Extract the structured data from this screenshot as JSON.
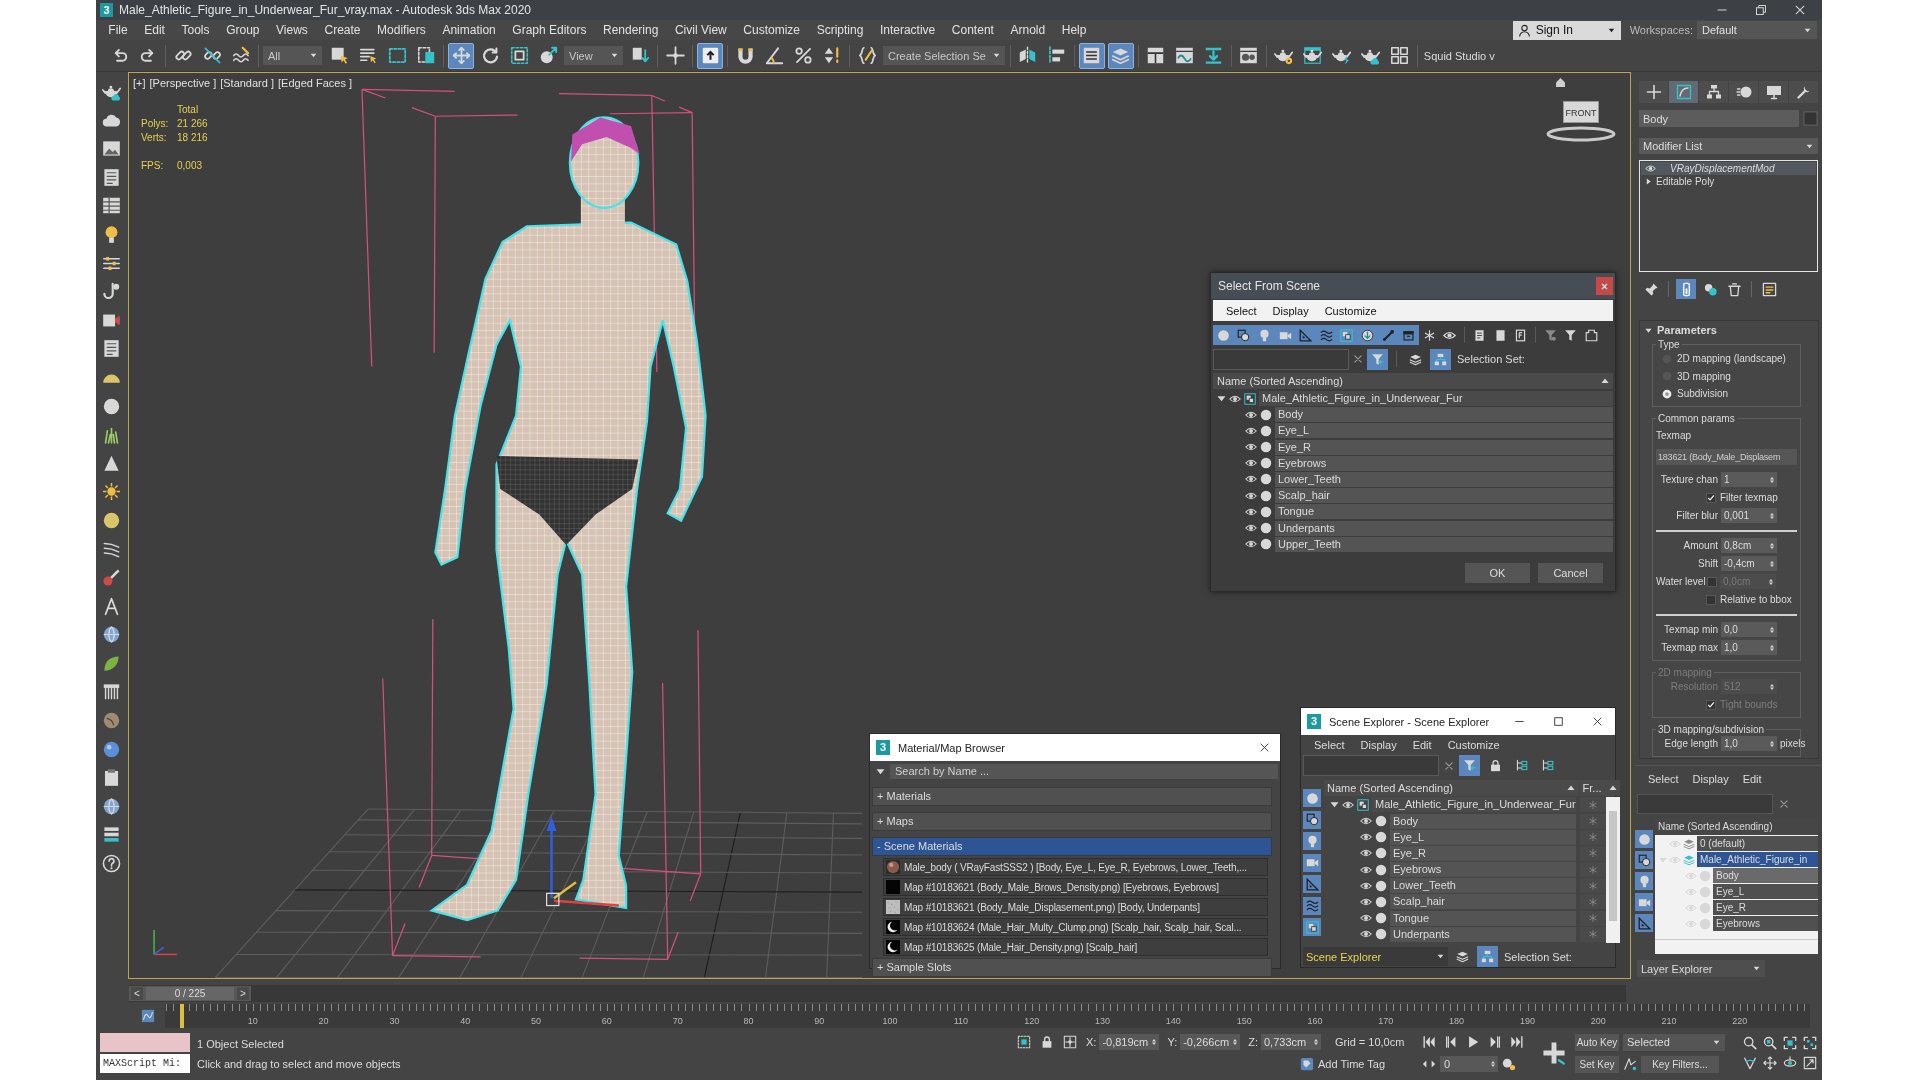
{
  "window": {
    "app_icon": "3",
    "title": "Male_Athletic_Figure_in_Underwear_Fur_vray.max - Autodesk 3ds Max 2020"
  },
  "menu_bar": {
    "items": [
      "File",
      "Edit",
      "Tools",
      "Group",
      "Views",
      "Create",
      "Modifiers",
      "Animation",
      "Graph Editors",
      "Rendering",
      "Civil View",
      "Customize",
      "Scripting",
      "Interactive",
      "Content",
      "Arnold",
      "Help"
    ],
    "sign_in": "Sign In",
    "workspaces_label": "Workspaces:",
    "workspace": "Default"
  },
  "main_toolbar": {
    "items": [
      {
        "kind": "tool",
        "selected": false
      },
      {
        "kind": "tool",
        "selected": false
      },
      {
        "kind": "separator"
      },
      {
        "kind": "tool",
        "selected": false
      },
      {
        "kind": "tool",
        "selected": false
      },
      {
        "kind": "tool",
        "selected": false
      },
      {
        "kind": "separator"
      },
      {
        "kind": "dropdown",
        "value": "All"
      },
      {
        "kind": "tool",
        "selected": false
      },
      {
        "kind": "tool",
        "selected": false
      },
      {
        "kind": "tool",
        "selected": false
      },
      {
        "kind": "tool",
        "selected": false
      },
      {
        "kind": "separator"
      },
      {
        "kind": "tool",
        "selected": true
      },
      {
        "kind": "tool",
        "selected": false
      },
      {
        "kind": "tool",
        "selected": false
      },
      {
        "kind": "tool",
        "selected": false
      },
      {
        "kind": "dropdown",
        "value": "View"
      },
      {
        "kind": "tool",
        "selected": false
      },
      {
        "kind": "separator"
      },
      {
        "kind": "tool",
        "selected": false
      },
      {
        "kind": "separator"
      },
      {
        "kind": "tool",
        "selected": true
      },
      {
        "kind": "separator"
      },
      {
        "kind": "tool",
        "selected": false
      },
      {
        "kind": "tool",
        "selected": false
      },
      {
        "kind": "tool",
        "selected": false
      },
      {
        "kind": "tool",
        "selected": false
      },
      {
        "kind": "separator"
      },
      {
        "kind": "tool",
        "selected": false
      },
      {
        "kind": "dropdown",
        "value": "Create Selection Se"
      },
      {
        "kind": "separator"
      },
      {
        "kind": "tool",
        "selected": false
      },
      {
        "kind": "tool",
        "selected": false
      },
      {
        "kind": "separator"
      },
      {
        "kind": "tool",
        "selected": true
      },
      {
        "kind": "tool",
        "selected": true
      },
      {
        "kind": "separator"
      },
      {
        "kind": "tool",
        "selected": false
      },
      {
        "kind": "tool",
        "selected": false
      },
      {
        "kind": "tool",
        "selected": false
      },
      {
        "kind": "separator"
      },
      {
        "kind": "tool",
        "selected": false
      },
      {
        "kind": "separator"
      },
      {
        "kind": "tool",
        "selected": false
      },
      {
        "kind": "tool",
        "selected": false
      },
      {
        "kind": "tool",
        "selected": false
      },
      {
        "kind": "tool",
        "selected": false
      },
      {
        "kind": "tool",
        "selected": false
      },
      {
        "kind": "separator"
      },
      {
        "kind": "label",
        "value": "Squid Studio v"
      }
    ]
  },
  "viewport": {
    "labels": [
      "[+]",
      "[Perspective ]",
      "[Standard ]",
      "[Edged Faces ]"
    ],
    "stats": {
      "heading": "Total",
      "rows": [
        {
          "label": "Polys:",
          "value": "21 266"
        },
        {
          "label": "Verts:",
          "value": "18 216"
        }
      ],
      "fps_label": "FPS:",
      "fps": "0,003"
    },
    "viewcube": "FRONT"
  },
  "select_from_scene": {
    "title": "Select From Scene",
    "menu": [
      "Select",
      "Display",
      "Customize"
    ],
    "filters": [
      {
        "selected": true
      },
      {
        "selected": true
      },
      {
        "selected": true
      },
      {
        "selected": true
      },
      {
        "selected": true
      },
      {
        "selected": true
      },
      {
        "selected": true
      },
      {
        "selected": true
      },
      {
        "selected": true
      },
      {
        "selected": true
      },
      {
        "selected": false
      },
      {
        "selected": false
      },
      {
        "selected": false
      },
      {
        "selected": false
      },
      {
        "selected": false
      },
      {
        "selected": false
      },
      {
        "selected": false
      },
      {
        "selected": false
      }
    ],
    "search_tools": [
      {
        "selected": true
      },
      {
        "selected": false
      },
      {
        "selected": true
      }
    ],
    "selection_set_label": "Selection Set:",
    "header": "Name (Sorted Ascending)",
    "tree": {
      "name": "Male_Athletic_Figure_in_Underwear_Fur",
      "selected": false,
      "expanded": true,
      "children": [
        {
          "name": "Body",
          "selected": false
        },
        {
          "name": "Eye_L",
          "selected": false
        },
        {
          "name": "Eye_R",
          "selected": false
        },
        {
          "name": "Eyebrows",
          "selected": false
        },
        {
          "name": "Lower_Teeth",
          "selected": false
        },
        {
          "name": "Scalp_hair",
          "selected": false
        },
        {
          "name": "Tongue",
          "selected": false
        },
        {
          "name": "Underpants",
          "selected": false
        },
        {
          "name": "Upper_Teeth",
          "selected": false
        }
      ]
    },
    "buttons": [
      "OK",
      "Cancel"
    ]
  },
  "material_browser": {
    "app_icon": "3",
    "title": "Material/Map Browser",
    "search_placeholder": "Search by Name ...",
    "groups": [
      {
        "label": "+ Materials",
        "selected": false
      },
      {
        "label": "+ Maps",
        "selected": false
      },
      {
        "label": "- Scene Materials",
        "selected": true,
        "items": [
          {
            "kind": "sphere",
            "text": "Male_body ( VRayFastSSS2 ) [Body, Eye_L, Eye_R, Eyebrows, Lower_Teeth,..."
          },
          {
            "kind": "solid",
            "text": "Map #10183621 (Body_Male_Brows_Density.png) [Eyebrows, Eyebrows]"
          },
          {
            "kind": "noise",
            "text": "Map #10183621 (Body_Male_Displasement.png) [Body, Underpants]"
          },
          {
            "kind": "crescent",
            "text": "Map #10183624 (Male_Hair_Multy_Clump.png) [Scalp_hair, Scalp_hair, Scal..."
          },
          {
            "kind": "crescent",
            "text": "Map #10183625 (Male_Hair_Density.png) [Scalp_hair]"
          }
        ]
      },
      {
        "label": "+ Sample Slots",
        "selected": false
      }
    ]
  },
  "scene_explorer": {
    "app_icon": "3",
    "title": "Scene Explorer - Scene Explorer",
    "menu": [
      "Select",
      "Display",
      "Edit",
      "Customize"
    ],
    "search_tools": [
      {
        "selected": true
      },
      {
        "selected": false
      },
      {
        "selected": false
      },
      {
        "selected": false
      }
    ],
    "side_filters": [
      {
        "selected": true
      },
      {
        "selected": true
      },
      {
        "selected": true
      },
      {
        "selected": true
      },
      {
        "selected": true
      },
      {
        "selected": true
      },
      {
        "selected": true
      }
    ],
    "header": "Name (Sorted Ascending)",
    "column_2": "Fr...",
    "tree": {
      "name": "Male_Athletic_Figure_in_Underwear_Fur",
      "selected": false,
      "expanded": true,
      "children": [
        {
          "name": "Body",
          "selected": false,
          "frozen": false
        },
        {
          "name": "Eye_L",
          "selected": false,
          "frozen": false
        },
        {
          "name": "Eye_R",
          "selected": false,
          "frozen": false
        },
        {
          "name": "Eyebrows",
          "selected": false,
          "frozen": false
        },
        {
          "name": "Lower_Teeth",
          "selected": false,
          "frozen": false
        },
        {
          "name": "Scalp_hair",
          "selected": false,
          "frozen": false
        },
        {
          "name": "Tongue",
          "selected": false,
          "frozen": false
        },
        {
          "name": "Underpants",
          "selected": false,
          "frozen": false
        }
      ]
    },
    "explorer_name": "Scene Explorer",
    "footer_tools": [
      {
        "selected": false
      },
      {
        "selected": true
      }
    ],
    "selection_set_label": "Selection Set:"
  },
  "command_panel": {
    "tabs": [
      {
        "selected": false
      },
      {
        "selected": true
      },
      {
        "selected": false
      },
      {
        "selected": false
      },
      {
        "selected": false
      },
      {
        "selected": false
      }
    ],
    "object_name": "Body",
    "modifier_list": "Modifier List",
    "stack": [
      {
        "kind": "modifier",
        "name": "VRayDisplacementMod",
        "selected": true
      },
      {
        "kind": "base",
        "name": "Editable Poly",
        "selected": false
      }
    ],
    "stack_buttons": [
      {
        "selected": false
      },
      {
        "selected": true
      },
      {
        "selected": false
      },
      {
        "selected": false
      },
      {
        "selected": false
      }
    ],
    "rollout": {
      "title": "Parameters",
      "expanded": true,
      "groups": [
        {
          "label": "Type",
          "disabled": false,
          "rows": [
            {
              "kind": "radio",
              "label": "2D mapping (landscape)",
              "selected": false
            },
            {
              "kind": "radio",
              "label": "3D mapping",
              "selected": false
            },
            {
              "kind": "radio",
              "label": "Subdivision",
              "selected": true
            }
          ]
        },
        {
          "label": "Common params",
          "disabled": false,
          "rows": [
            {
              "kind": "caption",
              "label": "Texmap"
            },
            {
              "kind": "map",
              "value": "183621 (Body_Male_Displasem"
            },
            {
              "kind": "spinner",
              "label": "Texture chan",
              "value": "1",
              "disabled": false
            },
            {
              "kind": "checkbox",
              "label": "Filter texmap",
              "checked": true,
              "disabled": false
            },
            {
              "kind": "spinner",
              "label": "Filter blur",
              "value": "0,001",
              "disabled": false
            },
            {
              "kind": "rule"
            },
            {
              "kind": "spinner",
              "label": "Amount",
              "value": "0,8cm",
              "disabled": false
            },
            {
              "kind": "spinner",
              "label": "Shift",
              "value": "-0,4cm",
              "disabled": false
            },
            {
              "kind": "check_spinner",
              "label": "Water level",
              "checked": false,
              "value": "0,0cm",
              "disabled": true
            },
            {
              "kind": "checkbox",
              "label": "Relative to bbox",
              "checked": false,
              "disabled": false
            },
            {
              "kind": "rule"
            },
            {
              "kind": "spinner",
              "label": "Texmap min",
              "value": "0,0",
              "disabled": false
            },
            {
              "kind": "spinner",
              "label": "Texmap max",
              "value": "1,0",
              "disabled": false
            }
          ]
        },
        {
          "label": "2D mapping",
          "disabled": true,
          "rows": [
            {
              "kind": "spinner",
              "label": "Resolution",
              "value": "512",
              "disabled": true
            },
            {
              "kind": "checkbox",
              "label": "Tight bounds",
              "checked": true,
              "disabled": true
            }
          ]
        },
        {
          "label": "3D mapping/subdivision",
          "disabled": false,
          "rows": [
            {
              "kind": "spinner",
              "label": "Edge length",
              "value": "1,0",
              "unit": "pixels",
              "disabled": false
            }
          ]
        }
      ]
    }
  },
  "layer_explorer": {
    "menu": [
      "Select",
      "Display",
      "Edit"
    ],
    "side_filters": [
      {
        "selected": true
      },
      {
        "selected": true
      },
      {
        "selected": true
      },
      {
        "selected": true
      },
      {
        "selected": true
      }
    ],
    "header": "Name (Sorted Ascending)",
    "layers": [
      {
        "name": "0 (default)",
        "selected": false,
        "current": false
      },
      {
        "name": "Male_Athletic_Figure_in",
        "selected": true,
        "current": true,
        "expanded": true,
        "children": [
          {
            "name": "Body",
            "selected": true
          },
          {
            "name": "Eye_L",
            "selected": false
          },
          {
            "name": "Eye_R",
            "selected": false
          },
          {
            "name": "Eyebrows",
            "selected": false
          }
        ]
      }
    ],
    "footer": "Layer Explorer"
  },
  "time_slider": {
    "prev": "<",
    "position": "0 / 225",
    "next": ">",
    "level": 0
  },
  "track_bar": {
    "ticks": [
      "10",
      "20",
      "30",
      "40",
      "50",
      "60",
      "70",
      "80",
      "90",
      "100",
      "110",
      "120",
      "130",
      "140",
      "150",
      "160",
      "170",
      "180",
      "190",
      "200",
      "210",
      "220"
    ]
  },
  "status_bar": {
    "listener": "MAXScript Mi:",
    "selection": "1 Object Selected",
    "prompt": "Click and drag to select and move objects",
    "coords": [
      {
        "label": "X:",
        "value": "-0,819cm"
      },
      {
        "label": "Y:",
        "value": "-0,266cm"
      },
      {
        "label": "Z:",
        "value": "0,733cm"
      }
    ],
    "grid": "Grid = 10,0cm",
    "time_tag": "Add Time Tag",
    "frame": "0",
    "auto_key": {
      "label": "Auto Key",
      "selected": false
    },
    "key_set": "Selected",
    "set_key": "Set Key",
    "key_filters": "Key Filters..."
  }
}
